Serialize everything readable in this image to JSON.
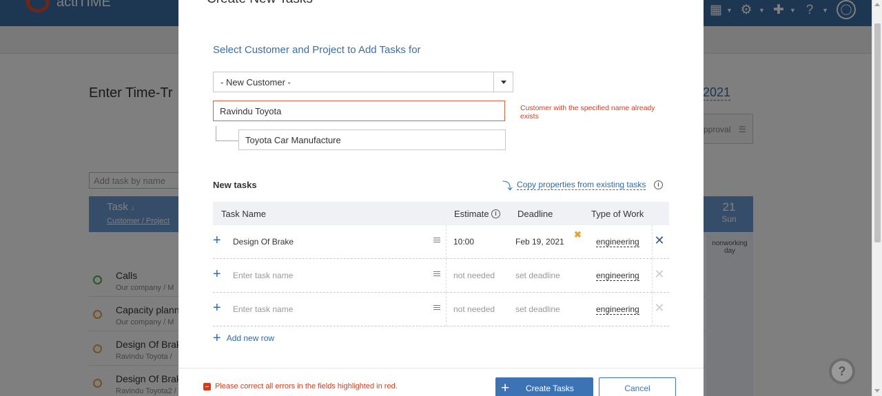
{
  "background": {
    "logo_text": "actiTIME",
    "page_title": "Enter Time-Tr",
    "date_link": "2021",
    "approval_text": "pproval",
    "add_task_placeholder": "Add task by name",
    "table_header": {
      "task": "Task",
      "customer": "Customer",
      "project": "Project"
    },
    "day": {
      "number": "21",
      "weekday": "Sun",
      "nonworking": "nonworking day"
    },
    "rows": [
      {
        "name": "Calls",
        "sub": "Our company  /  M"
      },
      {
        "name": "Capacity planni",
        "sub": "Our company  /  M"
      },
      {
        "name": "Design Of Brak",
        "sub": "Ravindu Toyota  /"
      },
      {
        "name": "Design Of Brak",
        "sub": "Ravindu Toyota2  /"
      }
    ],
    "help_label": "?"
  },
  "modal": {
    "title": "Create New Tasks",
    "section_title": "Select Customer and Project to Add Tasks for",
    "customer_select": "- New Customer -",
    "customer_name": "Ravindu Toyota",
    "customer_error": "Customer with the specified name already exists",
    "project_name": "Toyota Car Manufacture",
    "new_tasks_label": "New tasks",
    "copy_link": "Copy properties from existing tasks",
    "columns": {
      "task_name": "Task Name",
      "estimate": "Estimate",
      "deadline": "Deadline",
      "type_of_work": "Type of Work"
    },
    "tasks": [
      {
        "name": "Design Of Brake",
        "estimate": "10:00",
        "deadline": "Feb 19, 2021",
        "type_of_work": "engineering"
      },
      {
        "name_placeholder": "Enter task name",
        "estimate": "not needed",
        "deadline": "set deadline",
        "type_of_work": "engineering"
      },
      {
        "name_placeholder": "Enter task name",
        "estimate": "not needed",
        "deadline": "set deadline",
        "type_of_work": "engineering"
      }
    ],
    "add_row_label": "Add new row",
    "footer_error": "Please correct all errors in the fields highlighted in red.",
    "create_button": "Create Tasks",
    "cancel_button": "Cancel"
  },
  "icons": [
    "logo-icon",
    "calendar-icon",
    "gear-icon",
    "puzzle-icon",
    "help-icon",
    "bulb-icon",
    "info-icon",
    "plus-icon",
    "description-icon",
    "close-icon",
    "arrow-icon"
  ],
  "colors": {
    "accent": "#3b73b5",
    "error": "#d73b1a",
    "warning": "#e6a23c"
  }
}
